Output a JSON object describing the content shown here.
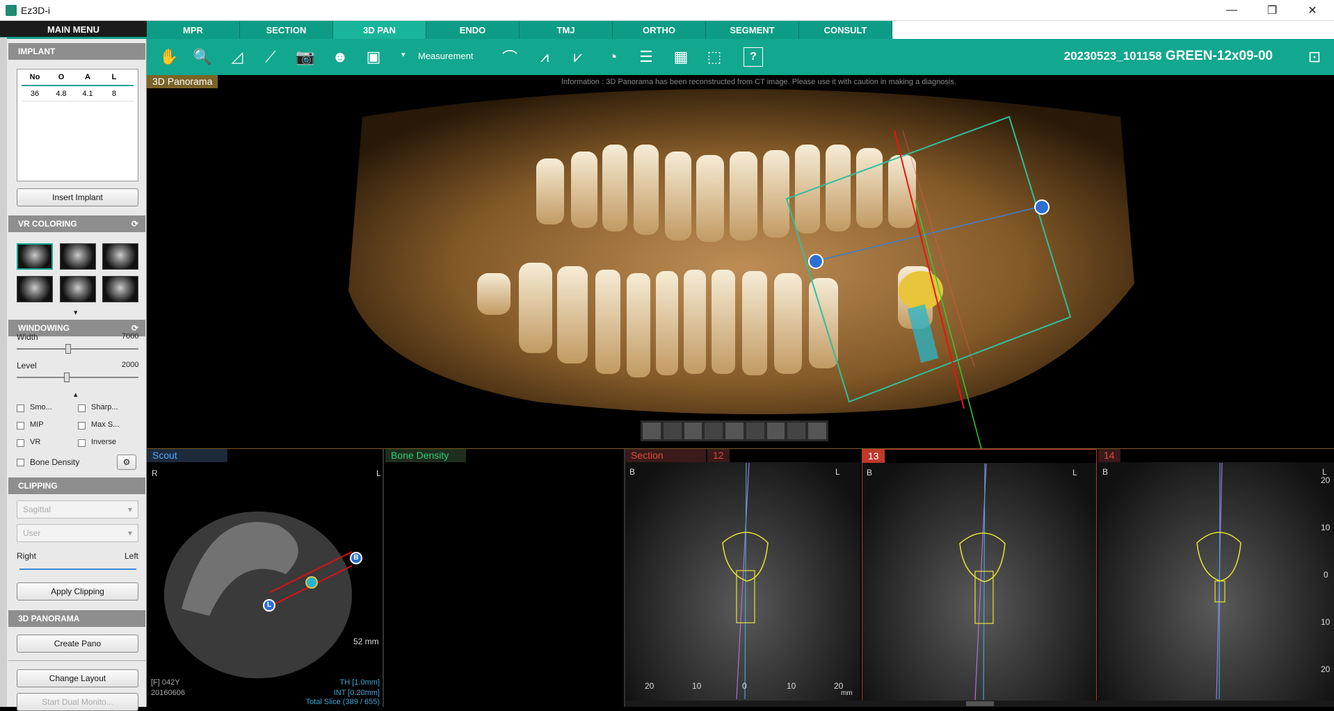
{
  "window": {
    "title": "Ez3D-i",
    "minimize": "—",
    "restore": "❐",
    "close": "✕"
  },
  "sidebar": {
    "main_menu": "MAIN MENU",
    "implant": {
      "header": "IMPLANT",
      "columns": [
        "No",
        "O",
        "A",
        "L"
      ],
      "rows": [
        [
          "36",
          "4.8",
          "4.1",
          "8"
        ]
      ],
      "insert_button": "Insert Implant"
    },
    "vr_coloring": {
      "header": "VR COLORING",
      "refresh_icon": "⟳",
      "more_icon": "▾",
      "presets": 6
    },
    "windowing": {
      "header": "WINDOWING",
      "width_label": "Width",
      "width_value": "7000",
      "level_label": "Level",
      "level_value": "2000",
      "collapse_icon": "▴",
      "options": [
        {
          "label": "Smo..."
        },
        {
          "label": "Sharp..."
        },
        {
          "label": "MIP"
        },
        {
          "label": "Max S..."
        },
        {
          "label": "VR"
        },
        {
          "label": "Inverse"
        },
        {
          "label": "Bone Density"
        }
      ]
    },
    "clipping": {
      "header": "CLIPPING",
      "plane": "Sagittal",
      "mode": "User",
      "right_label": "Right",
      "left_label": "Left",
      "apply_button": "Apply Clipping"
    },
    "panorama": {
      "header": "3D PANORAMA",
      "create_button": "Create Pano"
    },
    "change_layout": "Change Layout",
    "dual_monitor": "Start Dual Monito..."
  },
  "tabs": [
    {
      "label": "MPR"
    },
    {
      "label": "SECTION"
    },
    {
      "label": "3D PAN"
    },
    {
      "label": "ENDO"
    },
    {
      "label": "TMJ"
    },
    {
      "label": "ORTHO"
    },
    {
      "label": "SEGMENT"
    },
    {
      "label": "CONSULT"
    }
  ],
  "active_tab": "3D PAN",
  "toolbar": {
    "measurement_label": "Measurement",
    "measurement_arrow": "▾",
    "help_label": "?"
  },
  "patient": {
    "id": "20230523_101158",
    "name": "GREEN-12x09-00"
  },
  "pano": {
    "label": "3D Panorama",
    "info": "Information : 3D Panorama has been reconstructed from CT image. Please use it with caution in making a diagnosis."
  },
  "scout": {
    "label": "Scout",
    "right": "R",
    "left": "L",
    "marker_b": "B",
    "marker_l": "L",
    "scale": "52 mm",
    "patient_info": "[F] 042Y",
    "date": "20160606",
    "thickness": "TH [1.0mm]",
    "interval": "INT [0.20mm]",
    "total_slice": "Total Slice (389 / 655)"
  },
  "bone_density": {
    "label": "Bone Density"
  },
  "sections": [
    {
      "label": "Section",
      "index": "12",
      "b": "B",
      "l": "L"
    },
    {
      "index": "13",
      "b": "B",
      "l": "L"
    },
    {
      "index": "14",
      "b": "B",
      "l": "L"
    }
  ],
  "section_scale": {
    "y_ticks": [
      "20",
      "10",
      "0",
      "10",
      "20"
    ],
    "x_ticks": [
      "20",
      "10",
      "0",
      "10",
      "20"
    ],
    "unit": "mm"
  },
  "colors": {
    "accent": "#12a78f",
    "tab": "#0d9c85",
    "section_red": "#c0392b",
    "scout_blue": "#4aa8ff",
    "bone_green": "#2ecc71"
  }
}
